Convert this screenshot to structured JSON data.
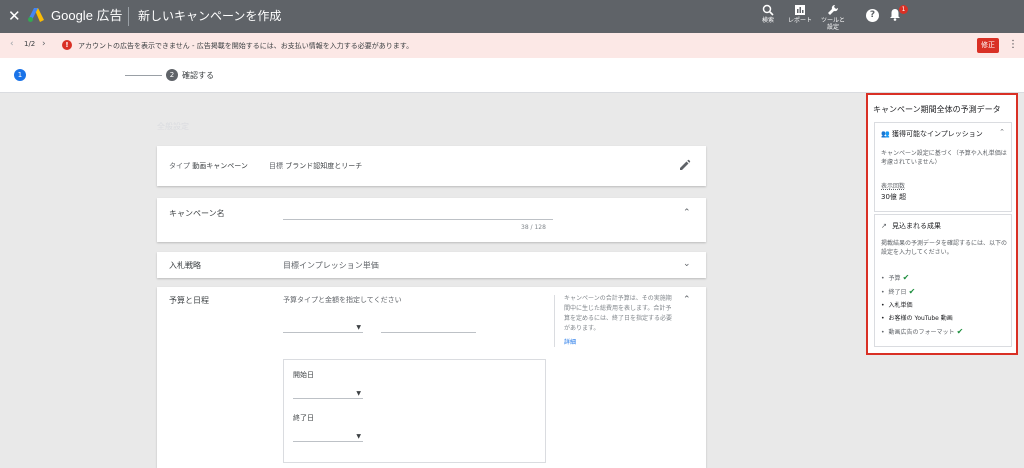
{
  "topbar": {
    "brand": "Google 広告",
    "page_title": "新しいキャンペーンを作成",
    "search_label": "検索",
    "reports_label": "レポート",
    "tools_label_1": "ツールと",
    "tools_label_2": "設定",
    "notification_count": "1",
    "colors": {
      "bar": "#5f6368",
      "badge": "#d93025"
    }
  },
  "alert": {
    "pager": "1/2",
    "message": "アカウントの広告を表示できません - 広告掲載を開始するには、お支払い情報を入力する必要があります。",
    "fix_label": "修正",
    "colors": {
      "background": "#fce8e6",
      "button": "#d93025"
    }
  },
  "stepper": {
    "steps": [
      {
        "number": "1",
        "label": "",
        "active": true
      },
      {
        "number": "2",
        "label": "確認する",
        "active": false
      }
    ]
  },
  "form": {
    "section_title": "全般設定",
    "type_card": {
      "type_key": "タイプ",
      "type_value": "動画キャンペーン",
      "goal_key": "目標",
      "goal_value": "ブランド認知度とリーチ"
    },
    "name_card": {
      "label": "キャンペーン名",
      "counter": "38 / 128"
    },
    "bid_card": {
      "label": "入札戦略",
      "value": "目標インプレッション単価"
    },
    "budget_card": {
      "label": "予算と日程",
      "hint": "予算タイプと金額を指定してください",
      "description": "キャンペーンの合計予算は、その実施期間中に生じた総費用を表します。合計予算を定めるには、終了日を指定する必要があります。",
      "link": "詳細",
      "start_label": "開始日",
      "end_label": "終了日"
    }
  },
  "forecast": {
    "title": "キャンペーン期間全体の予測データ",
    "impressions_card": {
      "title": "獲得可能なインプレッション",
      "body": "キャンペーン設定に基づく（予算や入札単価は考慮されていません）",
      "metric_label": "表示回数",
      "metric_value": "30億 超"
    },
    "results_card": {
      "title": "見込まれる成果",
      "body": "掲載結果の予測データを確認するには、以下の設定を入力してください。",
      "items": [
        {
          "label": "予算",
          "done": true
        },
        {
          "label": "終了日",
          "done": true
        },
        {
          "label": "入札単価",
          "done": false
        },
        {
          "label": "お客様の YouTube 動画",
          "done": false
        },
        {
          "label": "動画広告のフォーマット",
          "done": true
        }
      ]
    },
    "colors": {
      "border": "#d93025",
      "check": "#1e8e3e"
    }
  }
}
